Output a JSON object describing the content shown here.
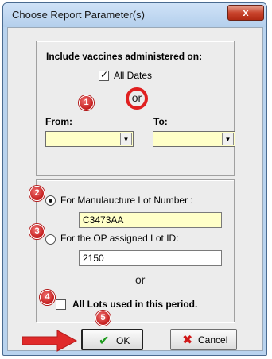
{
  "window": {
    "title": "Choose Report Parameter(s)",
    "close_glyph": "x"
  },
  "dates": {
    "heading": "Include vaccines administered on:",
    "all_dates_label": "All Dates",
    "all_dates_checked": true,
    "or_label": "or",
    "from_label": "From:",
    "to_label": "To:",
    "from_value": "",
    "to_value": ""
  },
  "lot": {
    "manufacturer_label": "For Manulaucture Lot Number :",
    "manufacturer_selected": true,
    "manufacturer_value": "C3473AA",
    "op_label": "For the OP assigned Lot ID:",
    "op_selected": false,
    "op_value": "2150",
    "or_label": "or",
    "all_lots_label": "All Lots used in this period.",
    "all_lots_checked": false
  },
  "buttons": {
    "ok_label": "OK",
    "cancel_label": "Cancel"
  },
  "annotations": {
    "badges": [
      "1",
      "2",
      "3",
      "4",
      "5"
    ],
    "badge_color": "#d42a2a",
    "arrow_color": "#e02a2a"
  },
  "colors": {
    "titlebar": "#c5dbf3",
    "input_yellow": "#ffffc8",
    "ok_check": "#1c9a1c",
    "cancel_x": "#d01818"
  }
}
